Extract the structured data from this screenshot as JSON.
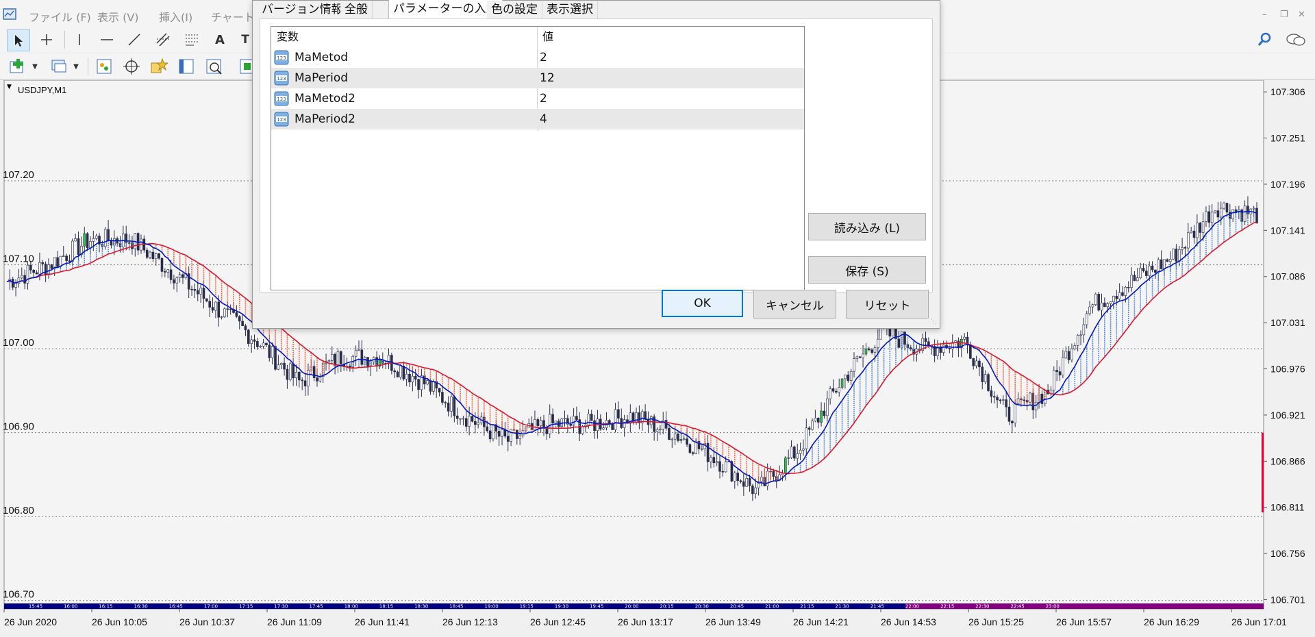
{
  "menu": {
    "items": [
      "ファイル (F)",
      "表示 (V)",
      "挿入(I)",
      "チャート ("
    ]
  },
  "icons": {
    "app": "mt4-app-icon",
    "toolbar1": [
      "cursor-arrow-icon",
      "crosshair-icon",
      "vertical-line-icon",
      "horizontal-line-icon",
      "trendline-icon",
      "equidistant-channel-icon",
      "fibonacci-icon",
      "text-icon",
      "text-label-icon"
    ],
    "toolbar2": [
      "new-chart-icon",
      "profiles-icon",
      "market-watch-icon",
      "navigator-icon",
      "data-window-icon",
      "terminal-icon",
      "strategy-tester-icon",
      "new-order-icon"
    ],
    "right": [
      "search-icon",
      "chat-icon"
    ]
  },
  "chart": {
    "symbol_label": "USDJPY,M1",
    "right_marker_color": "#e8003a",
    "candle_color": "#2a2d4a",
    "ma_fast_color": "#0018c8",
    "ma_slow_color": "#e0162b",
    "envelope_upper_color": "#ff6a4a",
    "envelope_lower_color": "#5d8fd0",
    "band_session1_color": "#000080",
    "band_session2_color": "#800080"
  },
  "chart_data": {
    "type": "line",
    "title": "",
    "xlabel": "",
    "ylabel": "",
    "symbol": "USDJPY,M1",
    "ylim": [
      106.69,
      107.32
    ],
    "y_ticks_right": [
      "107.306",
      "107.251",
      "107.196",
      "107.141",
      "107.086",
      "107.031",
      "106.976",
      "106.921",
      "106.866",
      "106.811",
      "106.756",
      "106.701"
    ],
    "y_ticks_left": [
      "107.20",
      "107.10",
      "107.00",
      "106.90",
      "106.80",
      "106.70"
    ],
    "x_ticks": [
      "26 Jun 2020",
      "26 Jun 10:05",
      "26 Jun 10:37",
      "26 Jun 11:09",
      "26 Jun 11:41",
      "26 Jun 12:13",
      "26 Jun 12:45",
      "26 Jun 13:17",
      "26 Jun 13:49",
      "26 Jun 14:21",
      "26 Jun 14:53",
      "26 Jun 15:25",
      "26 Jun 15:57",
      "26 Jun 16:29",
      "26 Jun 17:01"
    ],
    "session_ticks": [
      "15:45",
      "16:00",
      "16:15",
      "16:30",
      "16:45",
      "17:00",
      "17:15",
      "17:30",
      "17:45",
      "18:00",
      "18:15",
      "18:30",
      "18:45",
      "19:00",
      "19:15",
      "19:30",
      "19:45",
      "20:00",
      "20:15",
      "20:30",
      "20:45",
      "21:00",
      "21:15",
      "21:30",
      "21:45",
      "22:00",
      "22:15",
      "22:30",
      "22:45",
      "23:00"
    ],
    "series": [
      {
        "x": [
          0,
          5,
          10,
          15,
          20,
          25,
          30,
          35,
          40,
          45,
          50,
          55,
          60,
          65,
          70,
          75,
          80,
          85,
          90,
          95,
          100
        ],
        "values": [
          107.08,
          107.1,
          107.13,
          107.13,
          107.09,
          107.05,
          107.01,
          106.96,
          106.99,
          106.99,
          106.96,
          106.92,
          106.89,
          106.91,
          106.91,
          106.92,
          106.9,
          106.87,
          106.83,
          106.88,
          106.96
        ]
      },
      {
        "x": [
          100,
          105,
          110,
          115,
          120,
          125,
          130,
          135,
          140,
          145,
          150
        ],
        "values": [
          106.96,
          107.02,
          107.0,
          107.01,
          106.92,
          106.95,
          107.05,
          107.08,
          107.11,
          107.17,
          107.16
        ]
      }
    ]
  },
  "dialog": {
    "tabs": [
      "バージョン情報",
      "全般",
      "パラメーターの入力",
      "色の設定",
      "表示選択"
    ],
    "active_tab": "パラメーターの入力",
    "table": {
      "col_name": "変数",
      "col_value": "値",
      "rows": [
        {
          "name": "MaMetod",
          "value": "2",
          "icon": "integer-123-icon"
        },
        {
          "name": "MaPeriod",
          "value": "12",
          "icon": "integer-123-icon"
        },
        {
          "name": "MaMetod2",
          "value": "2",
          "icon": "integer-123-icon"
        },
        {
          "name": "MaPeriod2",
          "value": "4",
          "icon": "integer-123-icon"
        }
      ]
    },
    "buttons": {
      "load": "読み込み (L)",
      "save": "保存 (S)",
      "ok": "OK",
      "cancel": "キャンセル",
      "reset": "リセット"
    }
  }
}
